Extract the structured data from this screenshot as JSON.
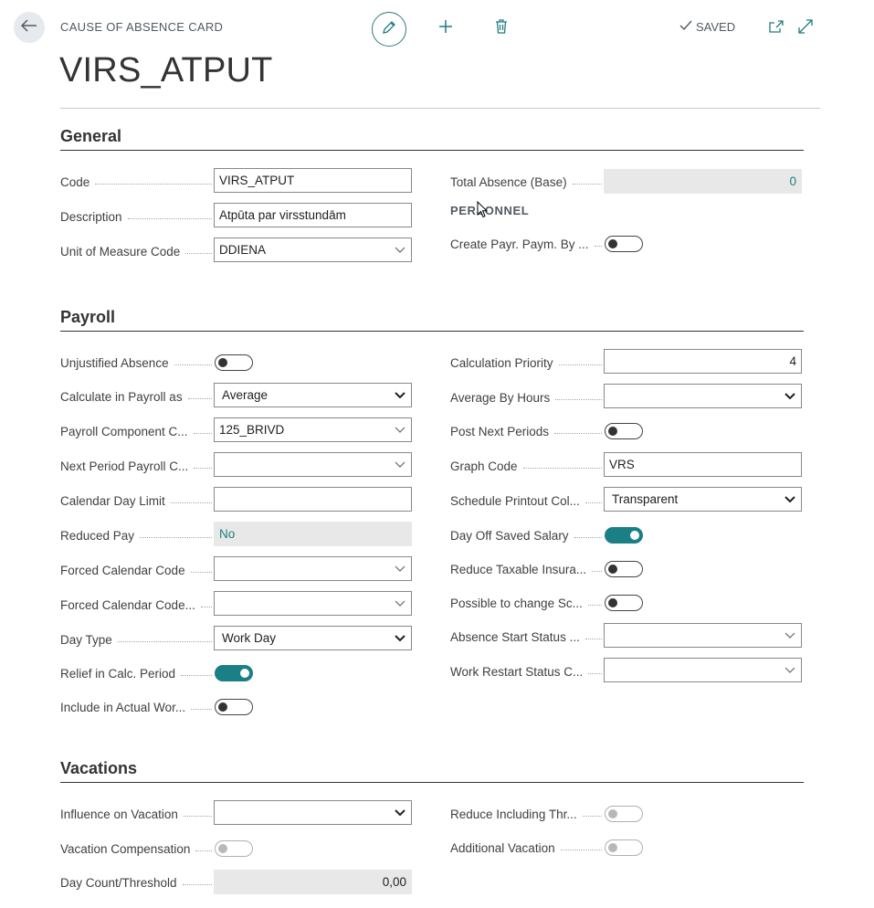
{
  "header": {
    "caption": "CAUSE OF ABSENCE CARD",
    "title": "VIRS_ATPUT",
    "saved_label": "SAVED",
    "icons": [
      "back-arrow-icon",
      "pencil-icon",
      "plus-icon",
      "trash-icon",
      "checkmark-icon",
      "open-new-window-icon",
      "expand-icon"
    ]
  },
  "general": {
    "title": "General",
    "code_label": "Code",
    "code_value": "VIRS_ATPUT",
    "description_label": "Description",
    "description_value": "Atpūta par virsstundām",
    "uom_label": "Unit of Measure Code",
    "uom_value": "DDIENA",
    "total_absence_label": "Total Absence (Base)",
    "total_absence_value": "0",
    "personnel_caption": "PERSONNEL",
    "create_payr_label": "Create Payr. Paym. By ...",
    "create_payr_on": false
  },
  "payroll": {
    "title": "Payroll",
    "left": [
      {
        "label": "Unjustified Absence",
        "type": "toggle",
        "on": false
      },
      {
        "label": "Calculate in Payroll as",
        "type": "select-bold",
        "value": "Average"
      },
      {
        "label": "Payroll Component C...",
        "type": "select",
        "value": "125_BRIVD"
      },
      {
        "label": "Next Period Payroll C...",
        "type": "select",
        "value": ""
      },
      {
        "label": "Calendar Day Limit",
        "type": "text",
        "value": ""
      },
      {
        "label": "Reduced Pay",
        "type": "readonly-link",
        "value": "No"
      },
      {
        "label": "Forced Calendar Code",
        "type": "select",
        "value": ""
      },
      {
        "label": "Forced Calendar Code...",
        "type": "select",
        "value": ""
      },
      {
        "label": "Day Type",
        "type": "select-bold",
        "value": "Work Day"
      },
      {
        "label": "Relief in Calc. Period",
        "type": "toggle",
        "on": true
      },
      {
        "label": "Include in Actual Wor...",
        "type": "toggle",
        "on": false
      }
    ],
    "right": [
      {
        "label": "Calculation Priority",
        "type": "number",
        "value": "4"
      },
      {
        "label": "Average By Hours",
        "type": "select-bold",
        "value": ""
      },
      {
        "label": "Post Next Periods",
        "type": "toggle",
        "on": false
      },
      {
        "label": "Graph Code",
        "type": "text",
        "value": "VRS"
      },
      {
        "label": "Schedule Printout Col...",
        "type": "select-bold",
        "value": "Transparent"
      },
      {
        "label": "Day Off Saved Salary",
        "type": "toggle",
        "on": true
      },
      {
        "label": "Reduce Taxable Insura...",
        "type": "toggle",
        "on": false
      },
      {
        "label": "Possible to change Sc...",
        "type": "toggle",
        "on": false
      },
      {
        "label": "Absence Start Status ...",
        "type": "select",
        "value": ""
      },
      {
        "label": "Work Restart Status C...",
        "type": "select",
        "value": ""
      }
    ]
  },
  "vacations": {
    "title": "Vacations",
    "influence_label": "Influence on Vacation",
    "influence_value": "",
    "compensation_label": "Vacation Compensation",
    "compensation_on": false,
    "threshold_label": "Day Count/Threshold",
    "threshold_value": "0,00",
    "reduce_label": "Reduce Including Thr...",
    "reduce_on": false,
    "additional_label": "Additional Vacation",
    "additional_on": false
  },
  "colors": {
    "accent": "#1b7f86",
    "link": "#1f7d80",
    "readonly_bg": "#e8e8e8"
  }
}
